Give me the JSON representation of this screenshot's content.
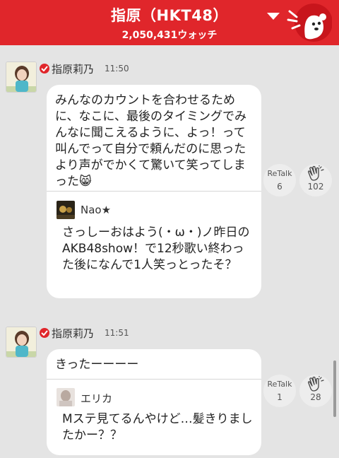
{
  "header": {
    "title": "指原（HKT48）",
    "watch_count": "2,050,431ウォッチ",
    "accent_color": "#e0262b",
    "dropdown_icon": "triangle-down-icon",
    "mascot_icon": "ghost-mascot-icon"
  },
  "posts": [
    {
      "author": "指原莉乃",
      "time": "11:50",
      "text": "みんなのカウントを合わせるために、なこに、最後のタイミングでみんなに聞こえるように、よっ！って叫んでって自分で頼んだのに思ったより声がでかくて驚いて笑ってしまった😸",
      "quote": {
        "author": "Nao★",
        "text": "さっしーおはよう(・ω・)ノ昨日のAKB48show！で12秒歌い終わった後になんで1人笑っとったそ？"
      },
      "retalk_label": "ReTalk",
      "retalk_count": "6",
      "clap_count": "102"
    },
    {
      "author": "指原莉乃",
      "time": "11:51",
      "text": "きったーーーー",
      "quote": {
        "author": "エリカ",
        "text": "Mステ見てるんやけど…髪きりましたかー？？"
      },
      "retalk_label": "ReTalk",
      "retalk_count": "1",
      "clap_count": "28"
    }
  ]
}
